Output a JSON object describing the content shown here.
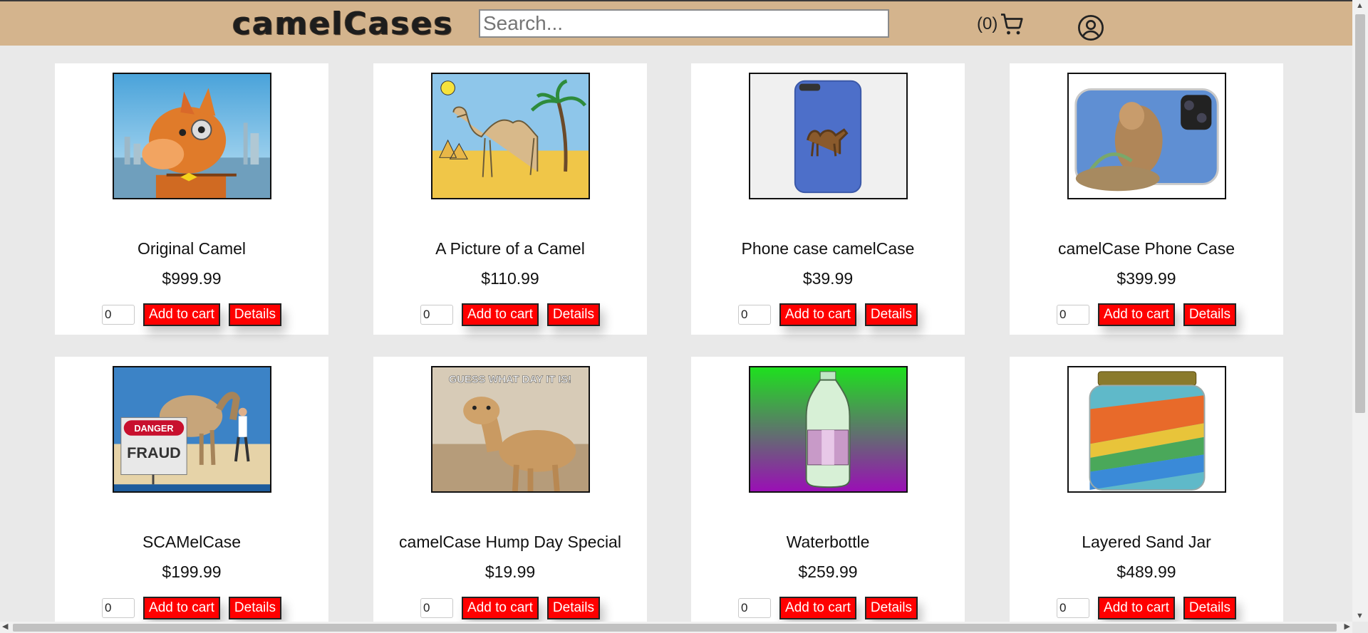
{
  "header": {
    "logo": "camelCases",
    "search_placeholder": "Search...",
    "search_value": "",
    "cart_count": "(0)"
  },
  "products": [
    {
      "name": "Original Camel",
      "price": "$999.99",
      "qty": "0",
      "add_label": "Add to cart",
      "details_label": "Details",
      "image": "cartoon-camel-with-monocle"
    },
    {
      "name": "A Picture of a Camel",
      "price": "$110.99",
      "qty": "0",
      "add_label": "Add to cart",
      "details_label": "Details",
      "image": "drawn-camel-desert"
    },
    {
      "name": "Phone case camelCase",
      "price": "$39.99",
      "qty": "0",
      "add_label": "Add to cart",
      "details_label": "Details",
      "image": "blue-phone-case-camel"
    },
    {
      "name": "camelCase Phone Case",
      "price": "$399.99",
      "qty": "0",
      "add_label": "Add to cart",
      "details_label": "Details",
      "image": "camel-photo-phone-case"
    },
    {
      "name": "SCAMelCase",
      "price": "$199.99",
      "qty": "0",
      "add_label": "Add to cart",
      "details_label": "Details",
      "image": "danger-fraud-camel-beach",
      "image_text": [
        "DANGER",
        "FRAUD"
      ]
    },
    {
      "name": "camelCase Hump Day Special",
      "price": "$19.99",
      "qty": "0",
      "add_label": "Add to cart",
      "details_label": "Details",
      "image": "hump-day-camel",
      "image_text": [
        "GUESS WHAT DAY IT IS!"
      ]
    },
    {
      "name": "Waterbottle",
      "price": "$259.99",
      "qty": "0",
      "add_label": "Add to cart",
      "details_label": "Details",
      "image": "water-bottle-gradient"
    },
    {
      "name": "Layered Sand Jar",
      "price": "$489.99",
      "qty": "0",
      "add_label": "Add to cart",
      "details_label": "Details",
      "image": "layered-sand-jar"
    }
  ],
  "colors": {
    "header_bg": "#d4b48d",
    "button_bg": "#ff0000",
    "page_bg": "#e9e9e9"
  },
  "icons": {
    "cart": "cart-icon",
    "account": "user-circle-icon"
  }
}
